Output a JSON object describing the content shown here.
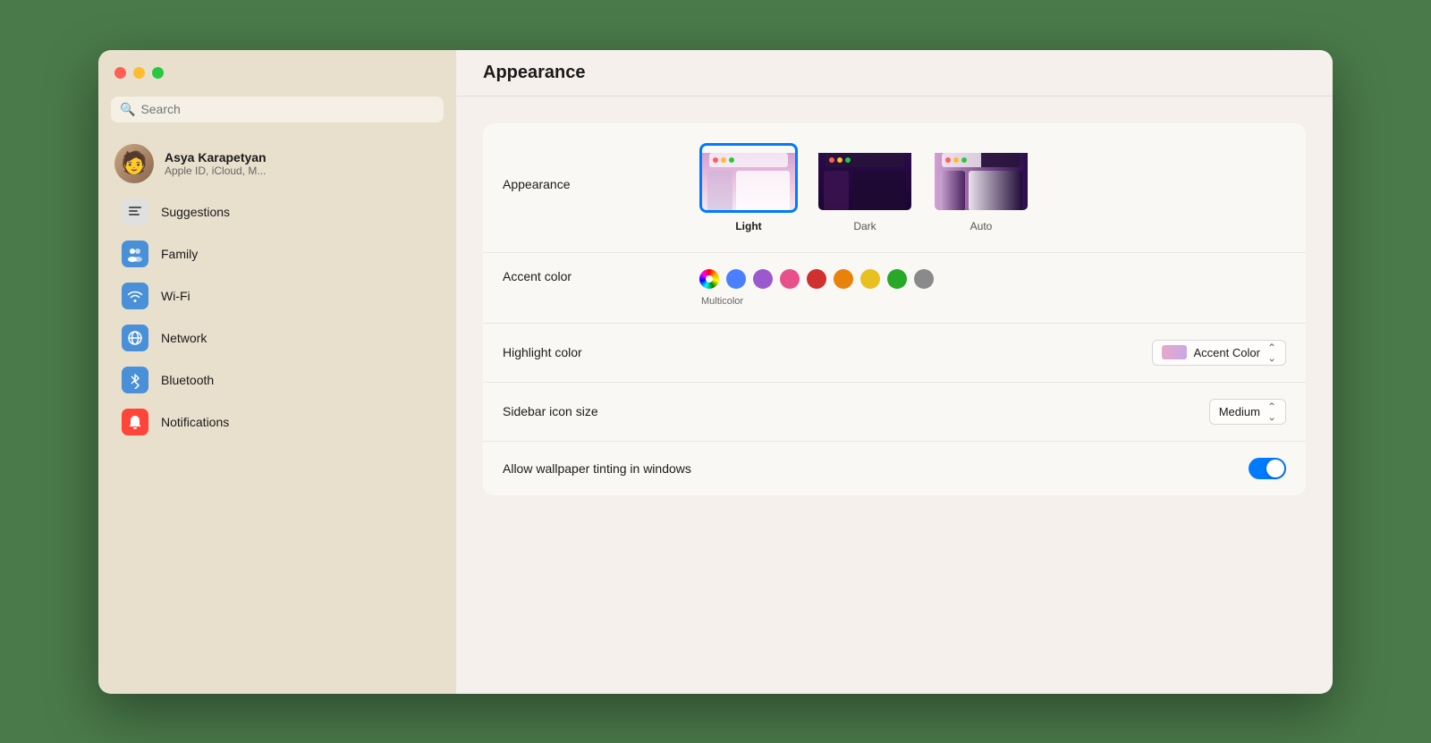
{
  "window": {
    "title": "Appearance"
  },
  "trafficLights": {
    "close": "close",
    "minimize": "minimize",
    "maximize": "maximize"
  },
  "sidebar": {
    "search": {
      "placeholder": "Search",
      "value": ""
    },
    "user": {
      "name": "Asya Karapetyan",
      "subtitle": "Apple ID, iCloud, M...",
      "emoji": "🧑"
    },
    "items": [
      {
        "id": "suggestions",
        "label": "Suggestions",
        "icon": "≡",
        "iconClass": "icon-suggestions"
      },
      {
        "id": "family",
        "label": "Family",
        "icon": "👥",
        "iconClass": "icon-family"
      },
      {
        "id": "wifi",
        "label": "Wi-Fi",
        "icon": "📶",
        "iconClass": "icon-wifi"
      },
      {
        "id": "network",
        "label": "Network",
        "icon": "🌐",
        "iconClass": "icon-network"
      },
      {
        "id": "bluetooth",
        "label": "Bluetooth",
        "icon": "✱",
        "iconClass": "icon-bluetooth"
      },
      {
        "id": "notifications",
        "label": "Notifications",
        "icon": "🔔",
        "iconClass": "icon-notifications"
      }
    ]
  },
  "main": {
    "title": "Appearance",
    "sections": {
      "appearance": {
        "label": "Appearance",
        "options": [
          {
            "id": "light",
            "label": "Light",
            "selected": true
          },
          {
            "id": "dark",
            "label": "Dark",
            "selected": false
          },
          {
            "id": "auto",
            "label": "Auto",
            "selected": false
          }
        ]
      },
      "accentColor": {
        "label": "Accent color",
        "selectedLabel": "Multicolor",
        "colors": [
          {
            "id": "multicolor",
            "color": "multicolor",
            "selected": true
          },
          {
            "id": "blue",
            "color": "#4a7fff"
          },
          {
            "id": "purple",
            "color": "#9b59d0"
          },
          {
            "id": "pink",
            "color": "#e8508c"
          },
          {
            "id": "red",
            "color": "#d03030"
          },
          {
            "id": "orange",
            "color": "#e8820a"
          },
          {
            "id": "yellow",
            "color": "#e8c020"
          },
          {
            "id": "green",
            "color": "#28a828"
          },
          {
            "id": "graphite",
            "color": "#8a8a8a"
          }
        ]
      },
      "highlightColor": {
        "label": "Highlight color",
        "value": "Accent Color"
      },
      "sidebarIconSize": {
        "label": "Sidebar icon size",
        "value": "Medium"
      },
      "wallpaperTinting": {
        "label": "Allow wallpaper tinting in windows",
        "enabled": true
      }
    }
  }
}
